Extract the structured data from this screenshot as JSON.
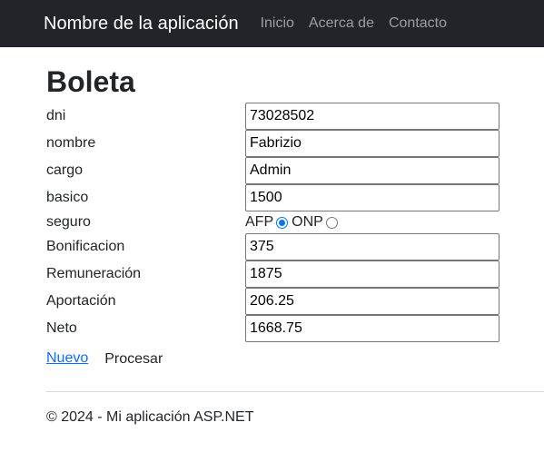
{
  "navbar": {
    "brand": "Nombre de la aplicación",
    "links": [
      "Inicio",
      "Acerca de",
      "Contacto"
    ]
  },
  "page": {
    "title": "Boleta"
  },
  "form": {
    "dni": {
      "label": "dni",
      "value": "73028502"
    },
    "nombre": {
      "label": "nombre",
      "value": "Fabrizio"
    },
    "cargo": {
      "label": "cargo",
      "value": "Admin"
    },
    "basico": {
      "label": "basico",
      "value": "1500"
    },
    "seguro": {
      "label": "seguro",
      "options": [
        {
          "label": "AFP",
          "selected": true
        },
        {
          "label": "ONP",
          "selected": false
        }
      ]
    },
    "bonificacion": {
      "label": "Bonificacion",
      "value": "375"
    },
    "remuneracion": {
      "label": "Remuneración",
      "value": "1875"
    },
    "aportacion": {
      "label": "Aportación",
      "value": "206.25"
    },
    "neto": {
      "label": "Neto",
      "value": "1668.75"
    }
  },
  "actions": {
    "nuevo": "Nuevo",
    "procesar": "Procesar"
  },
  "footer": {
    "text": "© 2024 - Mi aplicación ASP.NET"
  }
}
